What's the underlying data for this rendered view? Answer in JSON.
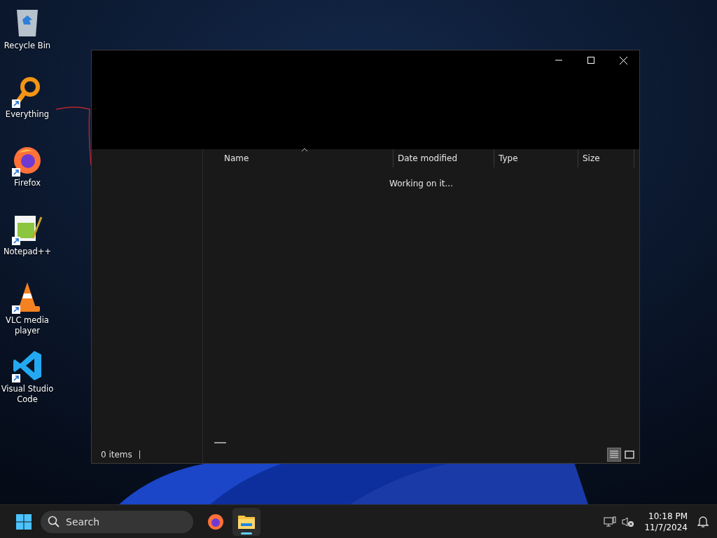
{
  "desktop_icons": [
    {
      "label": "Recycle Bin",
      "kind": "recycle",
      "shortcut": false
    },
    {
      "label": "Everything",
      "kind": "magnifier",
      "shortcut": true
    },
    {
      "label": "Firefox",
      "kind": "firefox",
      "shortcut": true
    },
    {
      "label": "Notepad++",
      "kind": "notepad",
      "shortcut": true
    },
    {
      "label": "VLC media player",
      "kind": "cone",
      "shortcut": true
    },
    {
      "label": "Visual Studio Code",
      "kind": "vscode",
      "shortcut": true
    }
  ],
  "window": {
    "columns": [
      {
        "label": "Name",
        "sorted": true
      },
      {
        "label": "Date modified",
        "sorted": false
      },
      {
        "label": "Type",
        "sorted": false
      },
      {
        "label": "Size",
        "sorted": false
      }
    ],
    "message": "Working on it...",
    "status": "0 items",
    "views": [
      {
        "kind": "details",
        "selected": true
      },
      {
        "kind": "tiles",
        "selected": false
      }
    ]
  },
  "taskbar": {
    "search_placeholder": "Search",
    "apps": [
      {
        "kind": "firefox",
        "selected": false
      },
      {
        "kind": "explorer",
        "selected": true
      }
    ],
    "time": "10:18 PM",
    "date": "11/7/2024"
  }
}
